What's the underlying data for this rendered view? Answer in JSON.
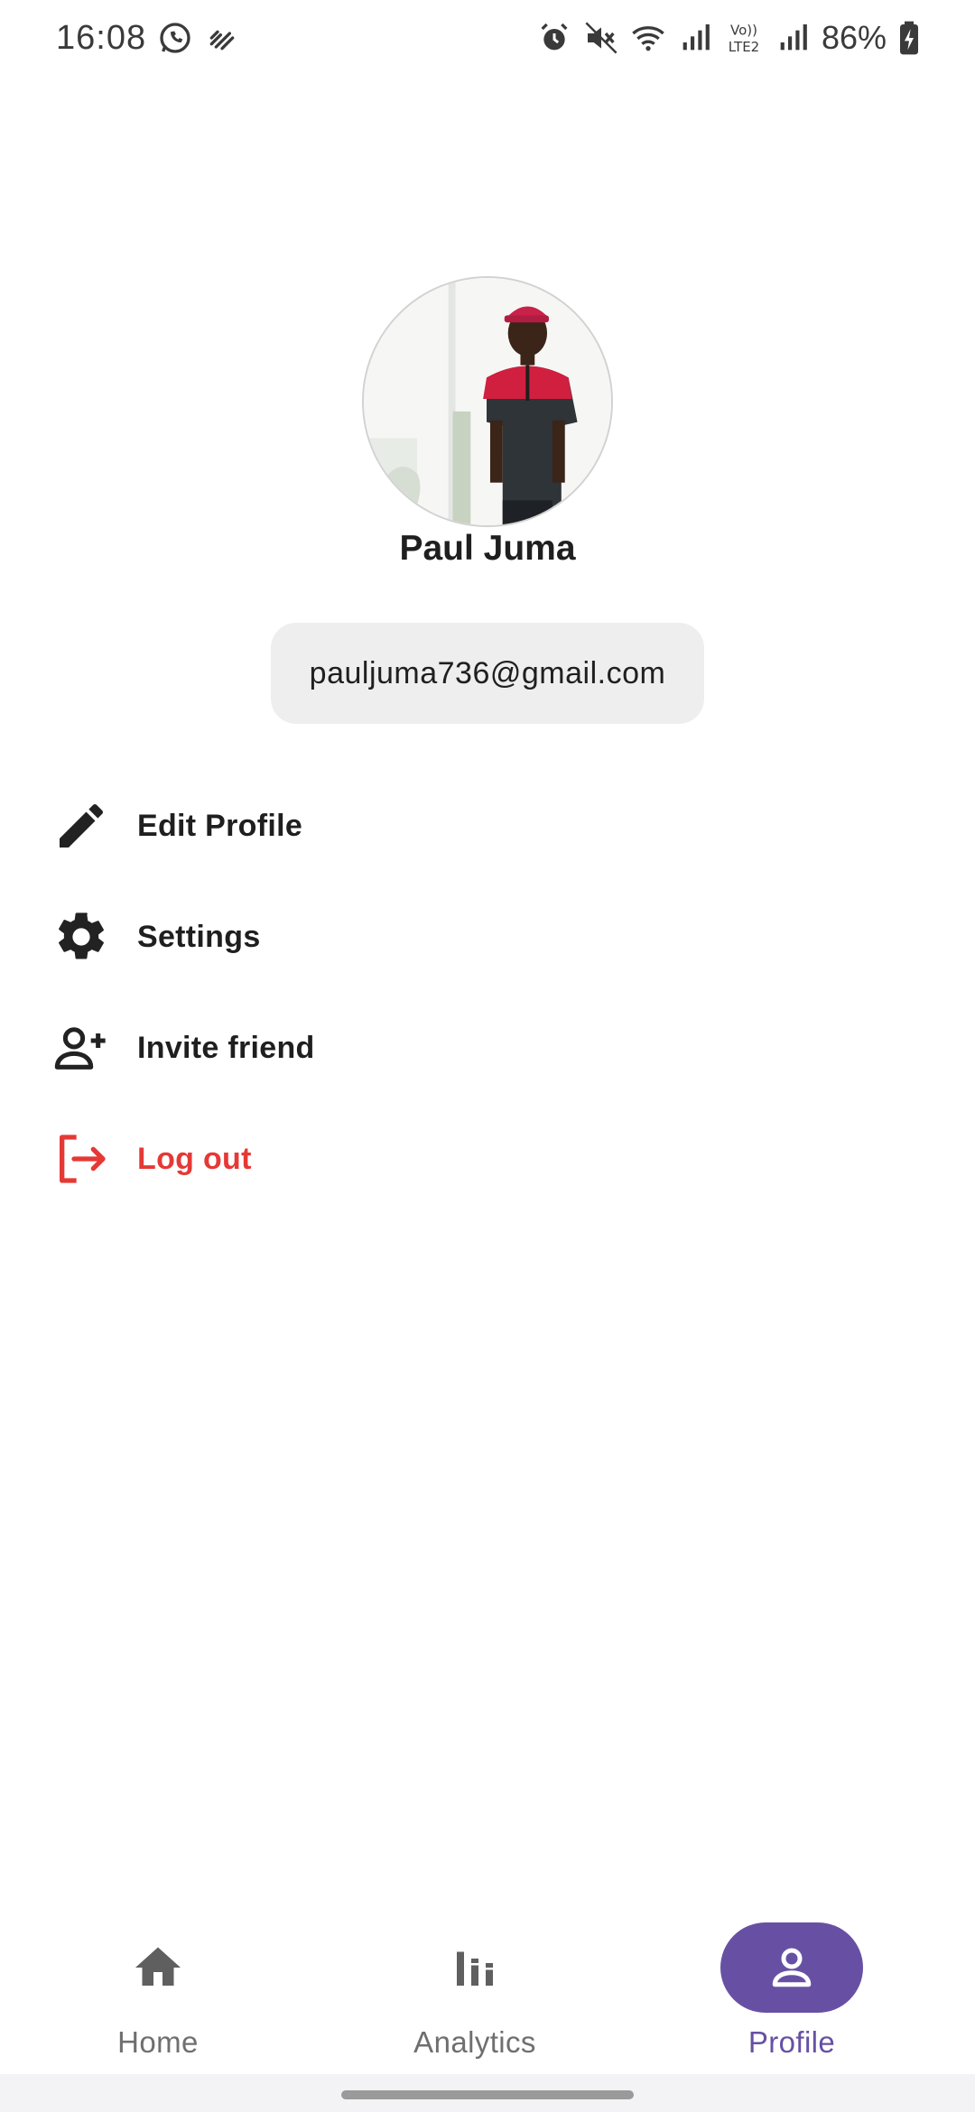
{
  "status_bar": {
    "time": "16:08",
    "battery": "86%",
    "icons": [
      "whatsapp-icon",
      "signal-activity-icon",
      "alarm-icon",
      "mute-icon",
      "wifi-icon",
      "cell-signal-icon",
      "volte-icon",
      "battery-charging-icon"
    ],
    "volte_label_top": "Vo))",
    "volte_label_bottom": "LTE2"
  },
  "profile": {
    "name": "Paul Juma",
    "email": "pauljuma736@gmail.com"
  },
  "menu": {
    "items": [
      {
        "label": "Edit Profile",
        "icon": "edit-pencil-icon"
      },
      {
        "label": "Settings",
        "icon": "gear-icon"
      },
      {
        "label": "Invite friend",
        "icon": "add-person-icon"
      },
      {
        "label": "Log out",
        "icon": "logout-icon"
      }
    ]
  },
  "bottom_nav": {
    "items": [
      {
        "label": "Home",
        "icon": "home-icon"
      },
      {
        "label": "Analytics",
        "icon": "bar-chart-icon"
      },
      {
        "label": "Profile",
        "icon": "person-icon"
      }
    ],
    "active": "Profile"
  },
  "colors": {
    "accent": "#6750a4",
    "logout": "#e53935",
    "chip_bg": "#eeeeee",
    "nav_inactive": "#6f6f6f"
  }
}
